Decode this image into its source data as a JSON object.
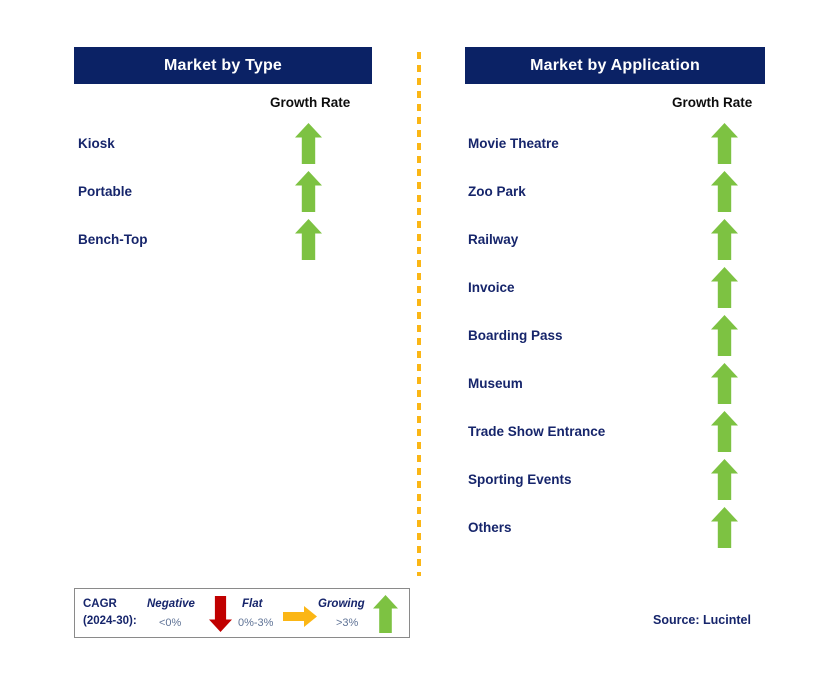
{
  "divider": {
    "icon": "dashed-vertical-divider",
    "color": "#fbb615"
  },
  "colors": {
    "header_navy": "#0b2265",
    "label_navy": "#16256b",
    "growing_green": "#7dc242",
    "negative_red": "#c00000",
    "flat_amber": "#fbb615"
  },
  "panels": [
    {
      "id": "type",
      "title": "Market by Type",
      "column_caption": "Growth Rate",
      "rows": [
        {
          "label": "Kiosk",
          "growth": "growing",
          "icon": "arrow-up-green"
        },
        {
          "label": "Portable",
          "growth": "growing",
          "icon": "arrow-up-green"
        },
        {
          "label": "Bench-Top",
          "growth": "growing",
          "icon": "arrow-up-green"
        }
      ]
    },
    {
      "id": "application",
      "title": "Market by Application",
      "column_caption": "Growth Rate",
      "rows": [
        {
          "label": "Movie Theatre",
          "growth": "growing",
          "icon": "arrow-up-green"
        },
        {
          "label": "Zoo Park",
          "growth": "growing",
          "icon": "arrow-up-green"
        },
        {
          "label": "Railway",
          "growth": "growing",
          "icon": "arrow-up-green"
        },
        {
          "label": "Invoice",
          "growth": "growing",
          "icon": "arrow-up-green"
        },
        {
          "label": "Boarding Pass",
          "growth": "growing",
          "icon": "arrow-up-green"
        },
        {
          "label": "Museum",
          "growth": "growing",
          "icon": "arrow-up-green"
        },
        {
          "label": "Trade Show Entrance",
          "growth": "growing",
          "icon": "arrow-up-green"
        },
        {
          "label": "Sporting Events",
          "growth": "growing",
          "icon": "arrow-up-green"
        },
        {
          "label": "Others",
          "growth": "growing",
          "icon": "arrow-up-green"
        }
      ]
    }
  ],
  "legend": {
    "cagr_line1": "CAGR",
    "cagr_line2": "(2024-30):",
    "entries": [
      {
        "term": "Negative",
        "range": "<0%",
        "icon": "arrow-down-red"
      },
      {
        "term": "Flat",
        "range": "0%-3%",
        "icon": "arrow-right-amber"
      },
      {
        "term": "Growing",
        "range": ">3%",
        "icon": "arrow-up-green"
      }
    ]
  },
  "source": "Source: Lucintel",
  "chart_data": {
    "type": "table",
    "title": "Market by Type and Market by Application — Growth Rate (CAGR 2024-30)",
    "columns": [
      "Segment",
      "Growth Rate"
    ],
    "legend_scale": [
      {
        "term": "Negative",
        "range": "<0%",
        "symbol": "down-arrow",
        "color": "#c00000"
      },
      {
        "term": "Flat",
        "range": "0%-3%",
        "symbol": "right-arrow",
        "color": "#fbb615"
      },
      {
        "term": "Growing",
        "range": ">3%",
        "symbol": "up-arrow",
        "color": "#7dc242"
      }
    ],
    "groups": [
      {
        "name": "Market by Type",
        "categories": [
          "Kiosk",
          "Portable",
          "Bench-Top"
        ],
        "values": [
          "Growing",
          "Growing",
          "Growing"
        ]
      },
      {
        "name": "Market by Application",
        "categories": [
          "Movie Theatre",
          "Zoo Park",
          "Railway",
          "Invoice",
          "Boarding Pass",
          "Museum",
          "Trade Show Entrance",
          "Sporting Events",
          "Others"
        ],
        "values": [
          "Growing",
          "Growing",
          "Growing",
          "Growing",
          "Growing",
          "Growing",
          "Growing",
          "Growing",
          "Growing"
        ]
      }
    ],
    "source": "Source: Lucintel"
  }
}
